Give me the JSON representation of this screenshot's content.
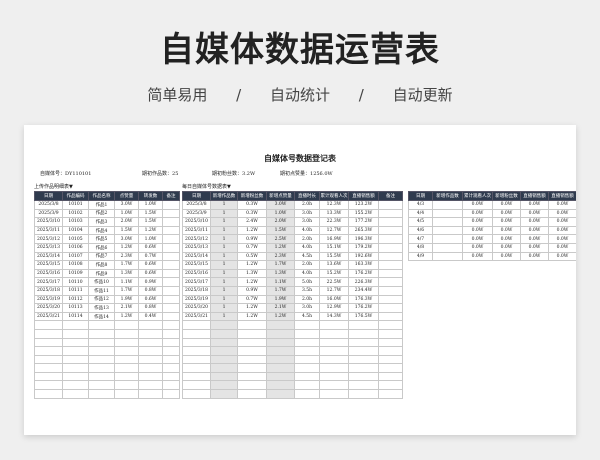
{
  "banner": {
    "title": "自媒体数据运营表",
    "tags": [
      "简单易用",
      "/",
      "自动统计",
      "/",
      "自动更新"
    ]
  },
  "sheet": {
    "title": "自媒体号数据登记表",
    "meta": [
      {
        "label": "自媒体号：",
        "value": "DY110101"
      },
      {
        "label": "期初作品数：",
        "value": "25"
      },
      {
        "label": "期初粉丝数：",
        "value": "3.2W"
      },
      {
        "label": "期初点赞量：",
        "value": "1256.0W"
      }
    ],
    "sections": [
      "上传作品明细表▼",
      "每日自媒体号数据表▼"
    ],
    "works": {
      "headers": [
        "日期",
        "作品编码",
        "作品名称",
        "点赞量",
        "转发数",
        "备注"
      ],
      "rows": [
        [
          "2025/3/8",
          "10101",
          "作品1",
          "3.0W",
          "1.0W",
          ""
        ],
        [
          "2025/3/9",
          "10102",
          "作品2",
          "1.0W",
          "1.5W",
          ""
        ],
        [
          "2025/3/10",
          "10103",
          "作品3",
          "2.0W",
          "1.5W",
          ""
        ],
        [
          "2025/3/11",
          "10104",
          "作品4",
          "1.5W",
          "1.2W",
          ""
        ],
        [
          "2025/3/12",
          "10105",
          "作品5",
          "3.0W",
          "1.0W",
          ""
        ],
        [
          "2025/3/13",
          "10106",
          "作品6",
          "1.2W",
          "0.6W",
          ""
        ],
        [
          "2025/3/14",
          "10107",
          "作品7",
          "2.3W",
          "0.7W",
          ""
        ],
        [
          "2025/3/15",
          "10108",
          "作品8",
          "1.7W",
          "0.6W",
          ""
        ],
        [
          "2025/3/16",
          "10109",
          "作品9",
          "1.3W",
          "0.6W",
          ""
        ],
        [
          "2025/3/17",
          "10110",
          "作品10",
          "1.1W",
          "0.9W",
          ""
        ],
        [
          "2025/3/18",
          "10111",
          "作品11",
          "1.7W",
          "0.8W",
          ""
        ],
        [
          "2025/3/19",
          "10112",
          "作品12",
          "1.9W",
          "0.6W",
          ""
        ],
        [
          "2025/3/20",
          "10113",
          "作品13",
          "2.1W",
          "0.8W",
          ""
        ],
        [
          "2025/3/21",
          "10114",
          "作品14",
          "1.2W",
          "0.4W",
          ""
        ]
      ]
    },
    "daily": {
      "headers": [
        "日期",
        "新增作品数",
        "新增粉丝数",
        "新增点赞量",
        "直播时长",
        "累计观看人次",
        "直播销售额",
        "备注"
      ],
      "rows": [
        [
          "2025/3/8",
          "1",
          "0.3W",
          "3.0W",
          "2.0h",
          "12.3W",
          "123.2W",
          ""
        ],
        [
          "2025/3/9",
          "1",
          "0.3W",
          "1.0W",
          "3.0h",
          "13.3W",
          "155.2W",
          ""
        ],
        [
          "2025/3/10",
          "1",
          "2.4W",
          "2.0W",
          "3.0h",
          "22.3W",
          "177.2W",
          ""
        ],
        [
          "2025/3/11",
          "1",
          "1.2W",
          "1.5W",
          "4.0h",
          "12.7W",
          "265.3W",
          ""
        ],
        [
          "2025/3/12",
          "1",
          "0.9W",
          "2.5W",
          "2.0h",
          "16.9W",
          "196.3W",
          ""
        ],
        [
          "2025/3/13",
          "1",
          "0.7W",
          "1.2W",
          "4.0h",
          "15.1W",
          "179.2W",
          ""
        ],
        [
          "2025/3/14",
          "1",
          "0.5W",
          "2.3W",
          "4.5h",
          "15.5W",
          "192.6W",
          ""
        ],
        [
          "2025/3/15",
          "1",
          "1.2W",
          "1.7W",
          "2.0h",
          "13.6W",
          "163.3W",
          ""
        ],
        [
          "2025/3/16",
          "1",
          "1.3W",
          "1.3W",
          "4.0h",
          "15.2W",
          "176.2W",
          ""
        ],
        [
          "2025/3/17",
          "1",
          "1.2W",
          "1.1W",
          "5.0h",
          "22.5W",
          "226.3W",
          ""
        ],
        [
          "2025/3/18",
          "1",
          "0.9W",
          "1.7W",
          "3.5h",
          "12.7W",
          "234.4W",
          ""
        ],
        [
          "2025/3/19",
          "1",
          "0.7W",
          "1.9W",
          "2.0h",
          "16.0W",
          "176.3W",
          ""
        ],
        [
          "2025/3/20",
          "1",
          "1.2W",
          "2.1W",
          "3.0h",
          "12.9W",
          "176.2W",
          ""
        ],
        [
          "2025/3/21",
          "1",
          "1.2W",
          "1.2W",
          "4.5h",
          "14.3W",
          "176.5W",
          ""
        ]
      ]
    },
    "summary": {
      "headers": [
        "日期",
        "新增作品数",
        "累计观看人次",
        "新增粉丝数",
        "直播销售额",
        "直播销售额"
      ],
      "rows": [
        [
          "4/3",
          "",
          "0.0W",
          "0.0W",
          "0.0W",
          "0.0W"
        ],
        [
          "4/4",
          "",
          "0.0W",
          "0.0W",
          "0.0W",
          "0.0W"
        ],
        [
          "4/5",
          "",
          "0.0W",
          "0.0W",
          "0.0W",
          "0.0W"
        ],
        [
          "4/6",
          "",
          "0.0W",
          "0.0W",
          "0.0W",
          "0.0W"
        ],
        [
          "4/7",
          "",
          "0.0W",
          "0.0W",
          "0.0W",
          "0.0W"
        ],
        [
          "4/8",
          "",
          "0.0W",
          "0.0W",
          "0.0W",
          "0.0W"
        ],
        [
          "4/9",
          "",
          "0.0W",
          "0.0W",
          "0.0W",
          "0.0W"
        ]
      ]
    }
  }
}
